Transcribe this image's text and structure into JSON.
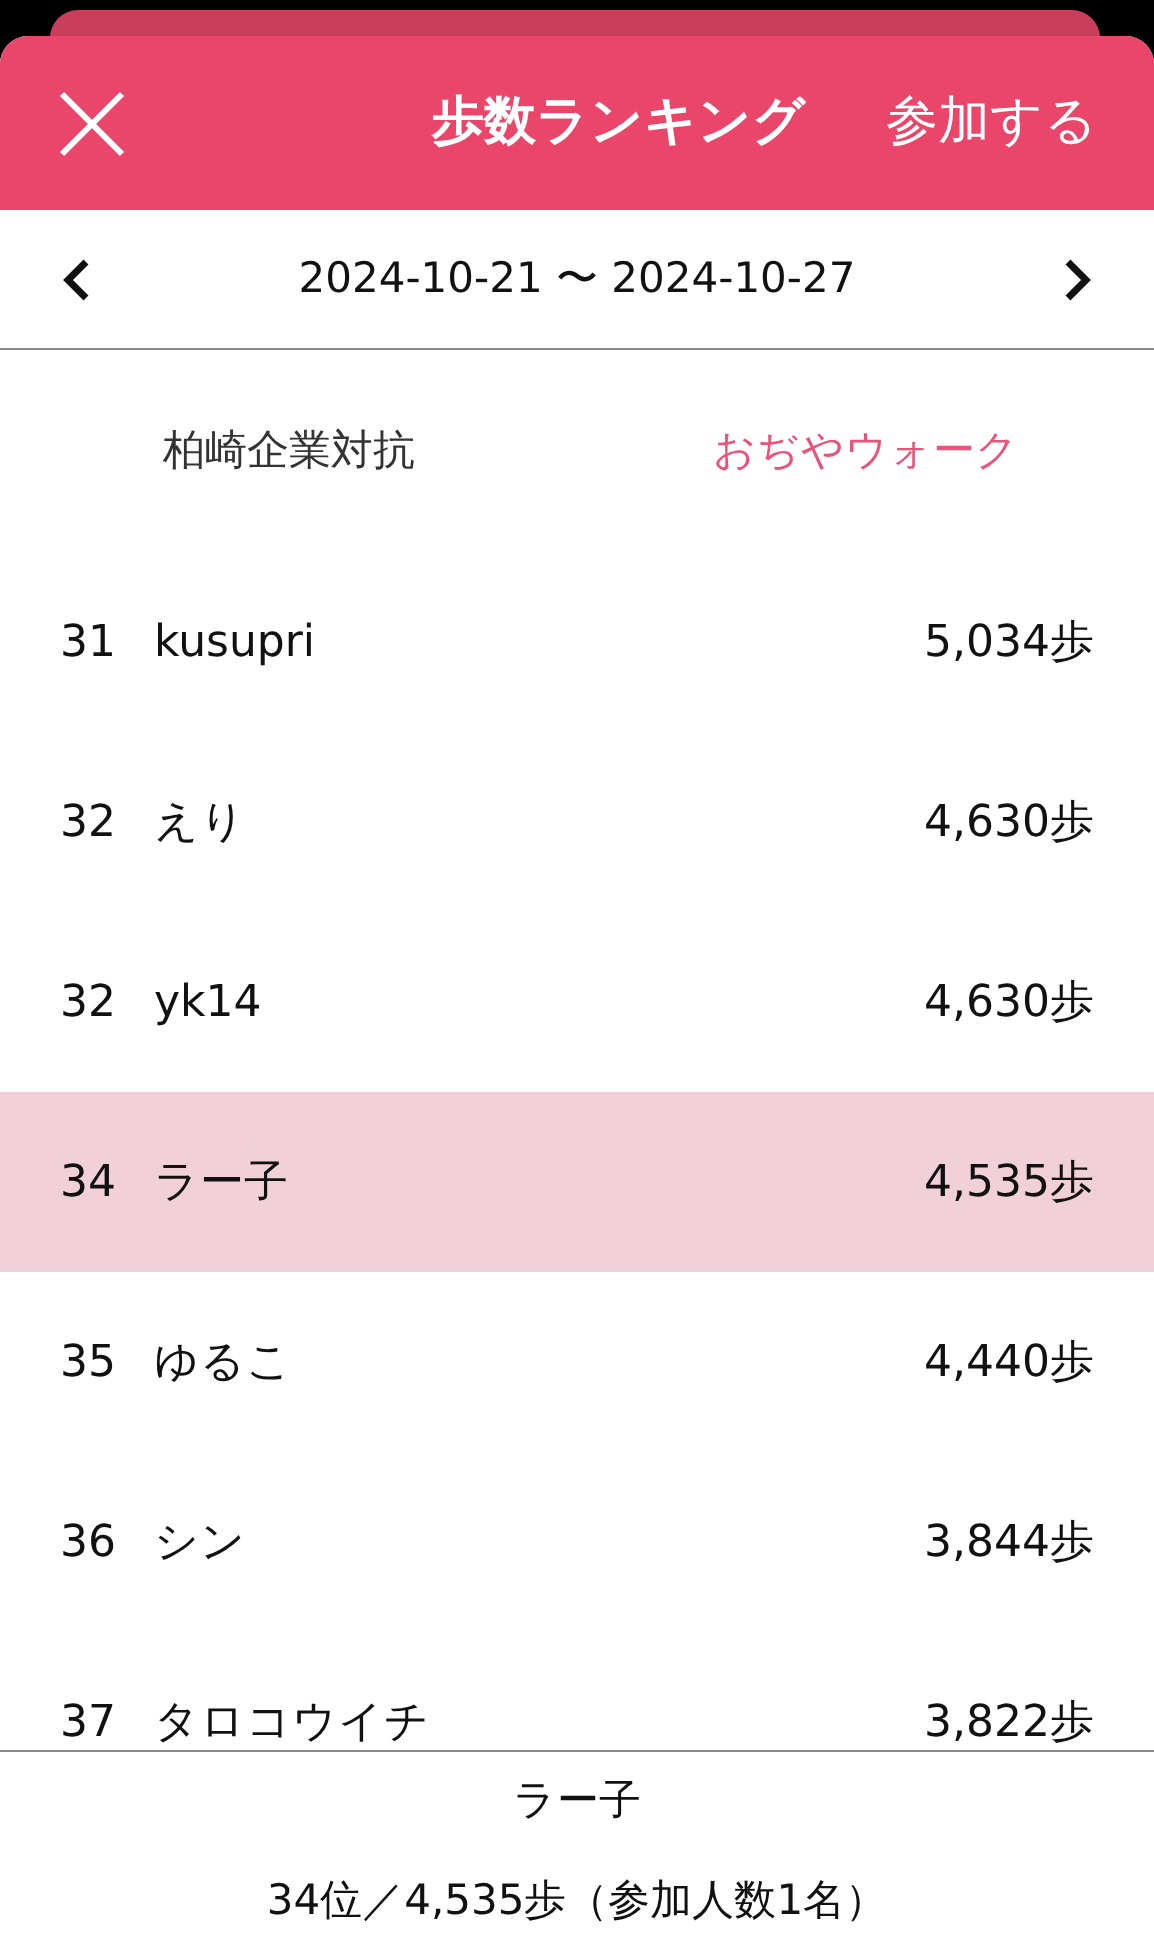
{
  "header": {
    "title": "歩数ランキング",
    "action": "参加する"
  },
  "date_range": {
    "label": "2024-10-21 〜 2024-10-27"
  },
  "tabs": [
    {
      "label": "柏崎企業対抗",
      "selected": false
    },
    {
      "label": "おぢやウォーク",
      "selected": true
    }
  ],
  "ranking": [
    {
      "rank": "31",
      "name": "kusupri",
      "steps": "5,034歩",
      "selected": false
    },
    {
      "rank": "32",
      "name": "えり",
      "steps": "4,630歩",
      "selected": false
    },
    {
      "rank": "32",
      "name": "yk14",
      "steps": "4,630歩",
      "selected": false
    },
    {
      "rank": "34",
      "name": "ラー子",
      "steps": "4,535歩",
      "selected": true
    },
    {
      "rank": "35",
      "name": "ゆるこ",
      "steps": "4,440歩",
      "selected": false
    },
    {
      "rank": "36",
      "name": "シン",
      "steps": "3,844歩",
      "selected": false
    },
    {
      "rank": "37",
      "name": "タロコウイチ",
      "steps": "3,822歩",
      "selected": false
    }
  ],
  "footer": {
    "name": "ラー子",
    "summary": "34位／4,535歩（参加人数1名）"
  }
}
